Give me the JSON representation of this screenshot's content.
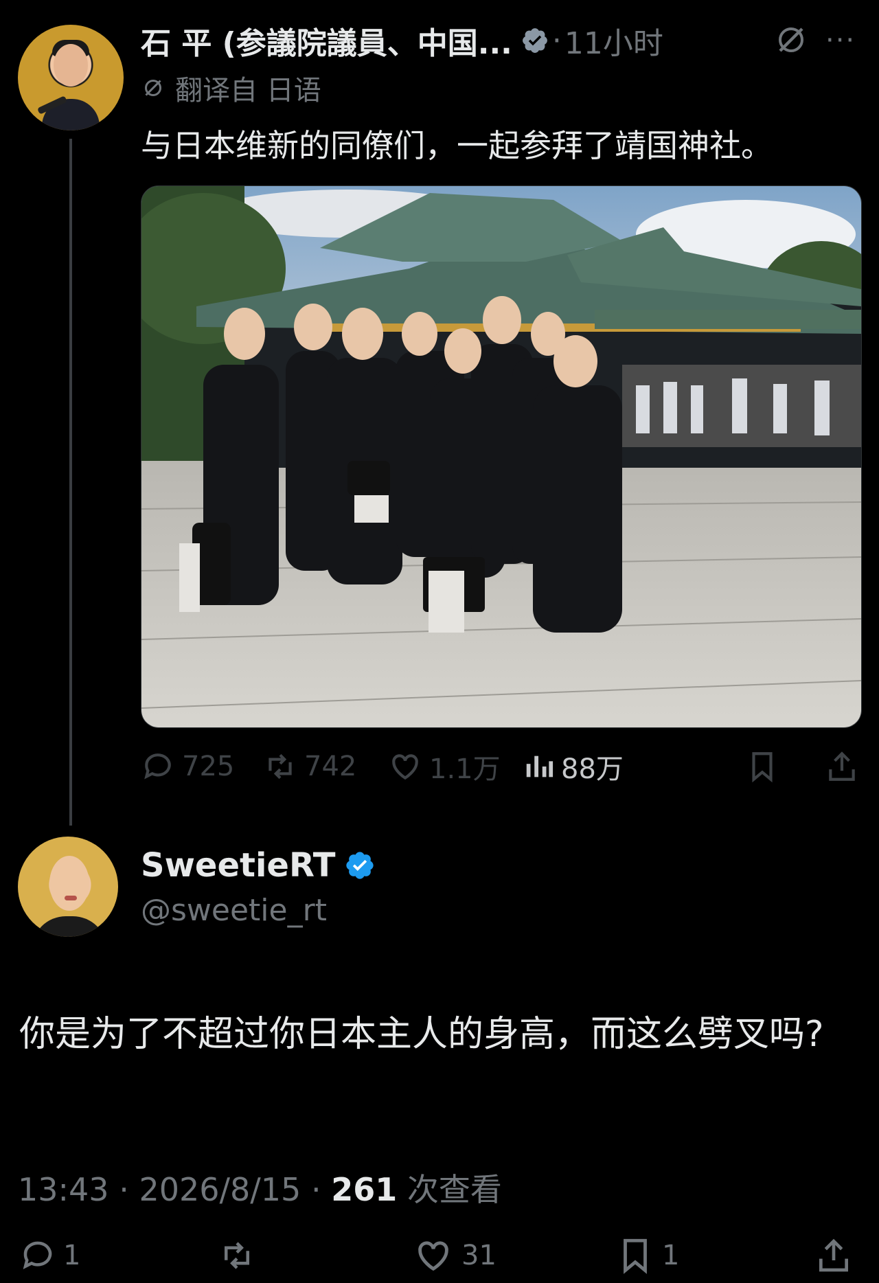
{
  "parent_tweet": {
    "author_name": "石 平 (参議院議員、中国...",
    "time_sep": "·",
    "time": "11小时",
    "translated_label": "翻译自 日语",
    "text": "与日本维新的同僚们，一起参拜了靖国神社。",
    "stats": {
      "replies": "725",
      "retweets": "742",
      "likes": "1.1万",
      "views": "88万"
    }
  },
  "reply_tweet": {
    "author_name": "SweetieRT",
    "handle": "@sweetie_rt",
    "text": "你是为了不超过你日本主人的身高，而这么劈叉吗?",
    "time": "13:43",
    "date": "2026/8/15",
    "sep": "·",
    "views_count": "261",
    "views_label": "次查看",
    "stats": {
      "replies": "1",
      "likes": "31",
      "bookmarks": "1"
    }
  },
  "colors": {
    "background": "#000000",
    "text_primary": "#e7e9ea",
    "text_secondary": "#71767b",
    "verified_blue": "#1d9bf0"
  },
  "icons": [
    "verified-badge-icon",
    "grok-icon",
    "more-icon",
    "translate-icon",
    "reply-icon",
    "retweet-icon",
    "like-icon",
    "views-icon",
    "bookmark-icon",
    "share-icon"
  ]
}
